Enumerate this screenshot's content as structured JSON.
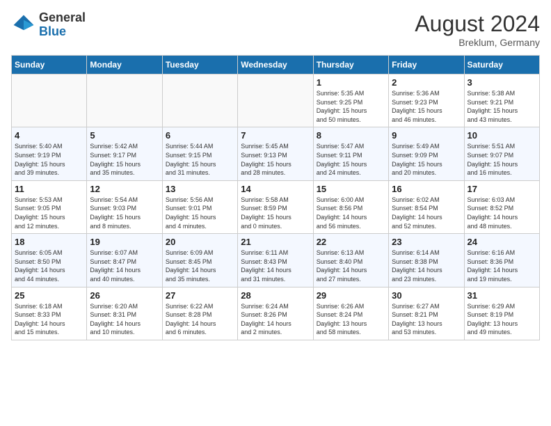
{
  "header": {
    "logo_general": "General",
    "logo_blue": "Blue",
    "month_title": "August 2024",
    "location": "Breklum, Germany"
  },
  "days_of_week": [
    "Sunday",
    "Monday",
    "Tuesday",
    "Wednesday",
    "Thursday",
    "Friday",
    "Saturday"
  ],
  "weeks": [
    [
      {
        "day": "",
        "detail": ""
      },
      {
        "day": "",
        "detail": ""
      },
      {
        "day": "",
        "detail": ""
      },
      {
        "day": "",
        "detail": ""
      },
      {
        "day": "1",
        "detail": "Sunrise: 5:35 AM\nSunset: 9:25 PM\nDaylight: 15 hours\nand 50 minutes."
      },
      {
        "day": "2",
        "detail": "Sunrise: 5:36 AM\nSunset: 9:23 PM\nDaylight: 15 hours\nand 46 minutes."
      },
      {
        "day": "3",
        "detail": "Sunrise: 5:38 AM\nSunset: 9:21 PM\nDaylight: 15 hours\nand 43 minutes."
      }
    ],
    [
      {
        "day": "4",
        "detail": "Sunrise: 5:40 AM\nSunset: 9:19 PM\nDaylight: 15 hours\nand 39 minutes."
      },
      {
        "day": "5",
        "detail": "Sunrise: 5:42 AM\nSunset: 9:17 PM\nDaylight: 15 hours\nand 35 minutes."
      },
      {
        "day": "6",
        "detail": "Sunrise: 5:44 AM\nSunset: 9:15 PM\nDaylight: 15 hours\nand 31 minutes."
      },
      {
        "day": "7",
        "detail": "Sunrise: 5:45 AM\nSunset: 9:13 PM\nDaylight: 15 hours\nand 28 minutes."
      },
      {
        "day": "8",
        "detail": "Sunrise: 5:47 AM\nSunset: 9:11 PM\nDaylight: 15 hours\nand 24 minutes."
      },
      {
        "day": "9",
        "detail": "Sunrise: 5:49 AM\nSunset: 9:09 PM\nDaylight: 15 hours\nand 20 minutes."
      },
      {
        "day": "10",
        "detail": "Sunrise: 5:51 AM\nSunset: 9:07 PM\nDaylight: 15 hours\nand 16 minutes."
      }
    ],
    [
      {
        "day": "11",
        "detail": "Sunrise: 5:53 AM\nSunset: 9:05 PM\nDaylight: 15 hours\nand 12 minutes."
      },
      {
        "day": "12",
        "detail": "Sunrise: 5:54 AM\nSunset: 9:03 PM\nDaylight: 15 hours\nand 8 minutes."
      },
      {
        "day": "13",
        "detail": "Sunrise: 5:56 AM\nSunset: 9:01 PM\nDaylight: 15 hours\nand 4 minutes."
      },
      {
        "day": "14",
        "detail": "Sunrise: 5:58 AM\nSunset: 8:59 PM\nDaylight: 15 hours\nand 0 minutes."
      },
      {
        "day": "15",
        "detail": "Sunrise: 6:00 AM\nSunset: 8:56 PM\nDaylight: 14 hours\nand 56 minutes."
      },
      {
        "day": "16",
        "detail": "Sunrise: 6:02 AM\nSunset: 8:54 PM\nDaylight: 14 hours\nand 52 minutes."
      },
      {
        "day": "17",
        "detail": "Sunrise: 6:03 AM\nSunset: 8:52 PM\nDaylight: 14 hours\nand 48 minutes."
      }
    ],
    [
      {
        "day": "18",
        "detail": "Sunrise: 6:05 AM\nSunset: 8:50 PM\nDaylight: 14 hours\nand 44 minutes."
      },
      {
        "day": "19",
        "detail": "Sunrise: 6:07 AM\nSunset: 8:47 PM\nDaylight: 14 hours\nand 40 minutes."
      },
      {
        "day": "20",
        "detail": "Sunrise: 6:09 AM\nSunset: 8:45 PM\nDaylight: 14 hours\nand 35 minutes."
      },
      {
        "day": "21",
        "detail": "Sunrise: 6:11 AM\nSunset: 8:43 PM\nDaylight: 14 hours\nand 31 minutes."
      },
      {
        "day": "22",
        "detail": "Sunrise: 6:13 AM\nSunset: 8:40 PM\nDaylight: 14 hours\nand 27 minutes."
      },
      {
        "day": "23",
        "detail": "Sunrise: 6:14 AM\nSunset: 8:38 PM\nDaylight: 14 hours\nand 23 minutes."
      },
      {
        "day": "24",
        "detail": "Sunrise: 6:16 AM\nSunset: 8:36 PM\nDaylight: 14 hours\nand 19 minutes."
      }
    ],
    [
      {
        "day": "25",
        "detail": "Sunrise: 6:18 AM\nSunset: 8:33 PM\nDaylight: 14 hours\nand 15 minutes."
      },
      {
        "day": "26",
        "detail": "Sunrise: 6:20 AM\nSunset: 8:31 PM\nDaylight: 14 hours\nand 10 minutes."
      },
      {
        "day": "27",
        "detail": "Sunrise: 6:22 AM\nSunset: 8:28 PM\nDaylight: 14 hours\nand 6 minutes."
      },
      {
        "day": "28",
        "detail": "Sunrise: 6:24 AM\nSunset: 8:26 PM\nDaylight: 14 hours\nand 2 minutes."
      },
      {
        "day": "29",
        "detail": "Sunrise: 6:26 AM\nSunset: 8:24 PM\nDaylight: 13 hours\nand 58 minutes."
      },
      {
        "day": "30",
        "detail": "Sunrise: 6:27 AM\nSunset: 8:21 PM\nDaylight: 13 hours\nand 53 minutes."
      },
      {
        "day": "31",
        "detail": "Sunrise: 6:29 AM\nSunset: 8:19 PM\nDaylight: 13 hours\nand 49 minutes."
      }
    ]
  ]
}
